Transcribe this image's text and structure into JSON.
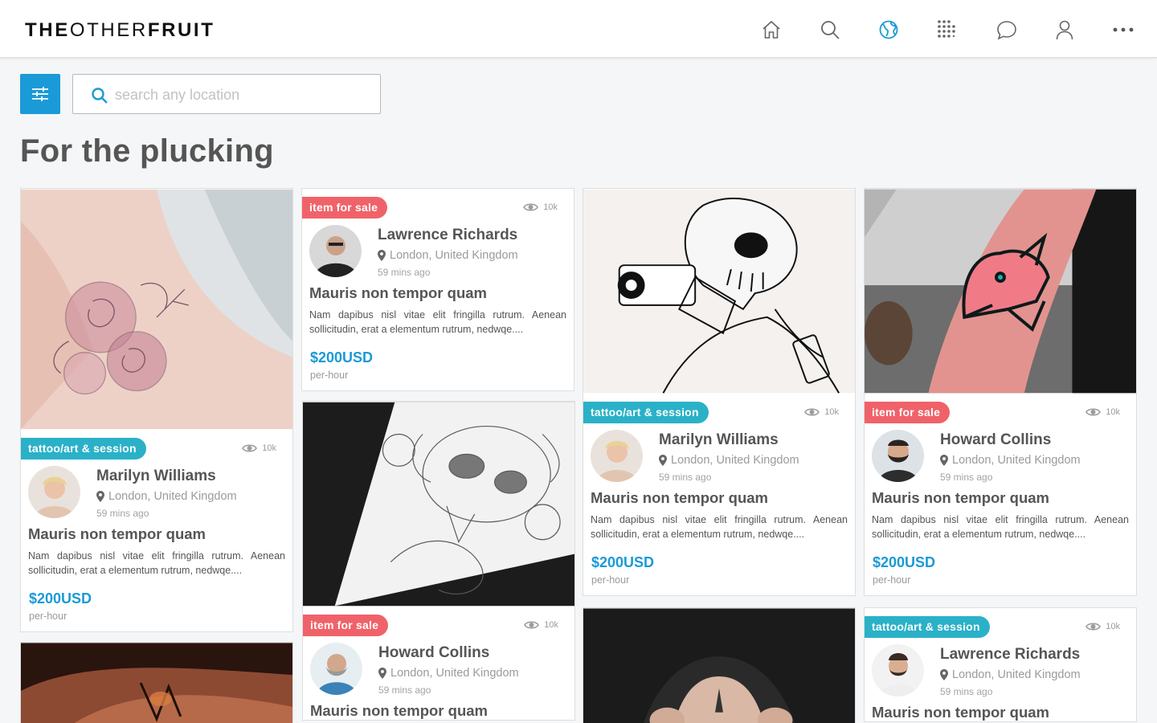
{
  "header": {
    "logo": {
      "part1": "THE",
      "part2": "OTHER",
      "part3": "FRUIT"
    },
    "nav_icons": [
      "home-icon",
      "search-icon",
      "globe-icon",
      "grid-dots-icon",
      "chat-icon",
      "user-icon",
      "more-icon"
    ],
    "active_nav": "globe-icon"
  },
  "search": {
    "placeholder": "search any location",
    "value": ""
  },
  "page_title": "For the plucking",
  "colors": {
    "accent": "#1a9ad6",
    "sale": "#f06269",
    "tattoo": "#2ab1c8"
  },
  "cards": [
    {
      "tag": "tattoo/art & session",
      "tag_type": "tattoo",
      "views": "10k",
      "name": "Marilyn Williams",
      "location": "London, United Kingdom",
      "time": "59 mins ago",
      "title": "Mauris non tempor quam",
      "description": "Nam dapibus nisl vitae elit fringilla rutrum. Aenean sollicitudin, erat a elementum rutrum, nedwqe....",
      "price": "$200USD",
      "unit": "per-hour"
    },
    {
      "tag": "item for sale",
      "tag_type": "sale",
      "views": "10k",
      "name": "Lawrence Richards",
      "location": "London, United Kingdom",
      "time": "59 mins ago",
      "title": "Mauris non tempor quam",
      "description": "Nam dapibus nisl vitae elit fringilla rutrum. Aenean sollicitudin, erat a elementum rutrum, nedwqe....",
      "price": "$200USD",
      "unit": "per-hour"
    },
    {
      "tag": "item for sale",
      "tag_type": "sale",
      "views": "10k",
      "name": "Howard Collins",
      "location": "London, United Kingdom",
      "time": "59 mins ago",
      "title": "Mauris non tempor quam",
      "description": "",
      "price": "",
      "unit": ""
    },
    {
      "tag": "tattoo/art & session",
      "tag_type": "tattoo",
      "views": "10k",
      "name": "Marilyn Williams",
      "location": "London, United Kingdom",
      "time": "59 mins ago",
      "title": "Mauris non tempor quam",
      "description": "Nam dapibus nisl vitae elit fringilla rutrum. Aenean sollicitudin, erat a elementum rutrum, nedwqe....",
      "price": "$200USD",
      "unit": "per-hour"
    },
    {
      "tag": "item for sale",
      "tag_type": "sale",
      "views": "10k",
      "name": "Howard Collins",
      "location": "London, United Kingdom",
      "time": "59 mins ago",
      "title": "Mauris non tempor quam",
      "description": "Nam dapibus nisl vitae elit fringilla rutrum. Aenean sollicitudin, erat a elementum rutrum, nedwqe....",
      "price": "$200USD",
      "unit": "per-hour"
    },
    {
      "tag": "tattoo/art & session",
      "tag_type": "tattoo",
      "views": "10k",
      "name": "Lawrence Richards",
      "location": "London, United Kingdom",
      "time": "59 mins ago",
      "title": "Mauris non tempor quam",
      "description": "",
      "price": "",
      "unit": ""
    }
  ]
}
